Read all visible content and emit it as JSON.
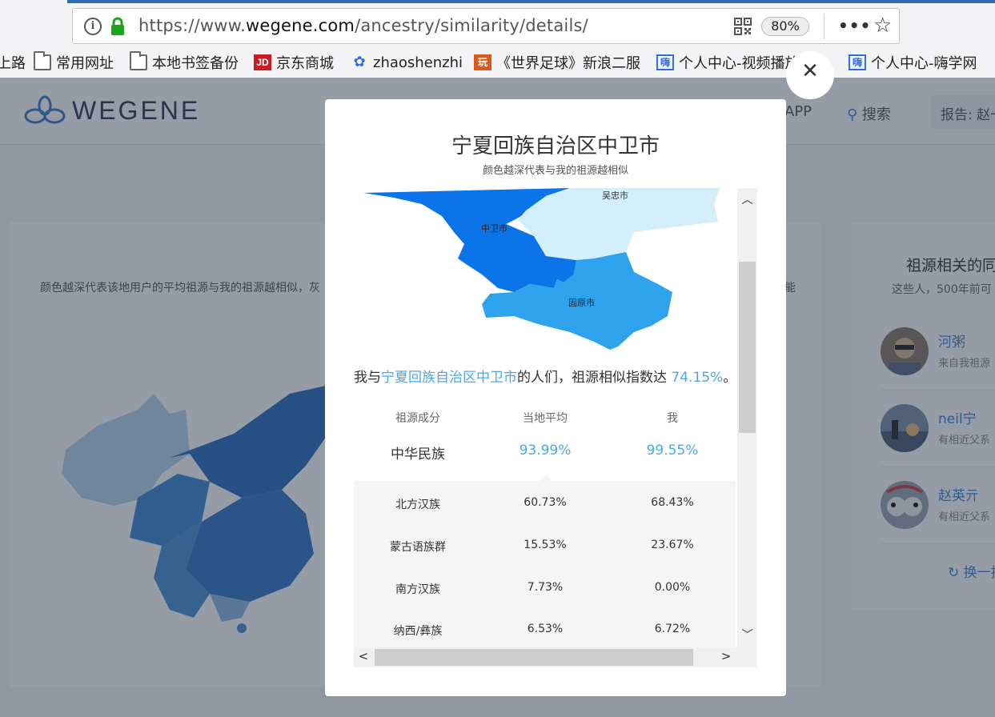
{
  "browser": {
    "url_prefix": "https://www.",
    "url_host": "wegene.com",
    "url_path": "/ancestry/similarity/details/",
    "zoom": "80%",
    "more_icon": "•••"
  },
  "bookmarks": [
    {
      "label": "上路",
      "icon": "none"
    },
    {
      "label": "常用网址",
      "icon": "folder-icon"
    },
    {
      "label": "本地书签备份",
      "icon": "folder-icon"
    },
    {
      "label": "京东商城",
      "icon": "jd-icon"
    },
    {
      "label": "zhaoshenzhi",
      "icon": "baidu-icon"
    },
    {
      "label": "《世界足球》新浪二服",
      "icon": "sina-icon"
    },
    {
      "label": "个人中心-视频播放页...",
      "icon": "hai-icon"
    },
    {
      "label": "个人中心-嗨学网",
      "icon": "hai-icon"
    }
  ],
  "site": {
    "logo_text": "WEGENE",
    "nav_app": "APP",
    "nav_search": "搜索",
    "nav_report": "报告: 赵一"
  },
  "background": {
    "left_desc": "颜色越深代表该地用户的平均祖源与我的祖源越相似，灰",
    "left_desc_right": "能",
    "right_title": "祖源相关的同",
    "right_sub": "这些人，500年前可",
    "people": [
      {
        "name": "河粥",
        "desc": "来自我祖源"
      },
      {
        "name": "neil宁",
        "desc": "有相近父系"
      },
      {
        "name": "赵英亓",
        "desc": "有相近父系"
      }
    ],
    "refresh": "换一批"
  },
  "modal": {
    "title": "宁夏回族自治区中卫市",
    "subtitle": "颜色越深代表与我的祖源越相似",
    "map_labels": {
      "wuzhong": "吴忠市",
      "zhongwei": "中卫市",
      "guyuan": "固原市"
    },
    "summary_prefix": "我与",
    "summary_place": "宁夏回族自治区中卫市",
    "summary_mid": "的人们，祖源相似指数达 ",
    "summary_value": "74.15%",
    "summary_end": "。",
    "table": {
      "headers": [
        "祖源成分",
        "当地平均",
        "我"
      ],
      "main_row": {
        "name": "中华民族",
        "local": "93.99%",
        "me": "99.55%"
      },
      "rows": [
        {
          "name": "北方汉族",
          "local": "60.73%",
          "me": "68.43%"
        },
        {
          "name": "蒙古语族群",
          "local": "15.53%",
          "me": "23.67%"
        },
        {
          "name": "南方汉族",
          "local": "7.73%",
          "me": "0.00%"
        },
        {
          "name": "纳西/彝族",
          "local": "6.53%",
          "me": "6.72%"
        }
      ]
    }
  },
  "colors": {
    "accent": "#4aa8e8",
    "zhongwei": "#0a74e8",
    "guyuan": "#2fa2ee",
    "wuzhong": "#d3effb"
  }
}
